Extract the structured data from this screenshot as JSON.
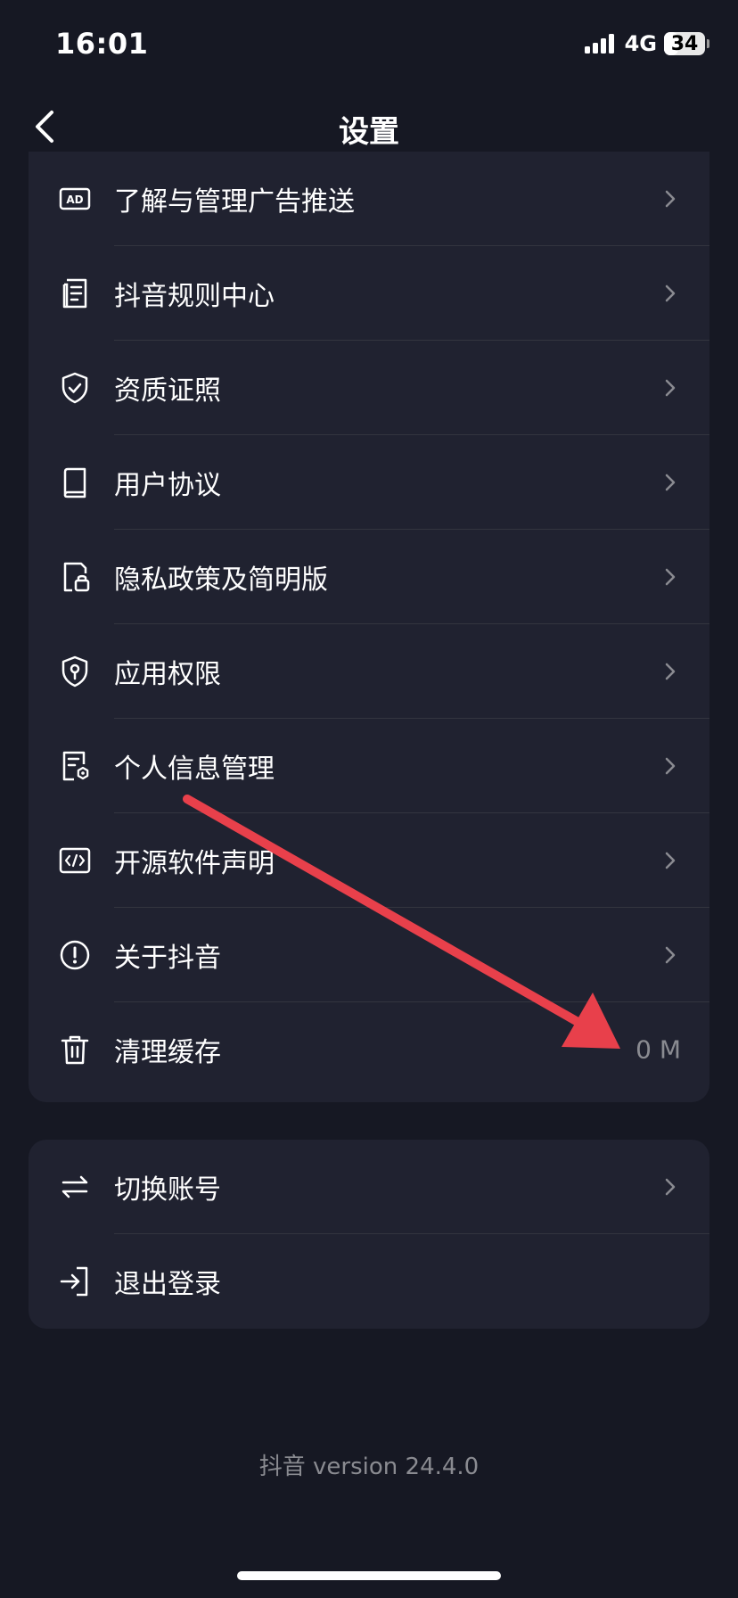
{
  "status_bar": {
    "time": "16:01",
    "network": "4G",
    "battery": "34",
    "battery_level_percent": 34
  },
  "header": {
    "title": "设置"
  },
  "settings_items": [
    {
      "label": "了解与管理广告推送",
      "icon": "ad-icon"
    },
    {
      "label": "抖音规则中心",
      "icon": "document-list-icon"
    },
    {
      "label": "资质证照",
      "icon": "shield-check-icon"
    },
    {
      "label": "用户协议",
      "icon": "book-icon"
    },
    {
      "label": "隐私政策及简明版",
      "icon": "lock-document-icon"
    },
    {
      "label": "应用权限",
      "icon": "shield-key-icon"
    },
    {
      "label": "个人信息管理",
      "icon": "document-settings-icon"
    },
    {
      "label": "开源软件声明",
      "icon": "code-icon"
    },
    {
      "label": "关于抖音",
      "icon": "info-circle-icon"
    },
    {
      "label": "清理缓存",
      "icon": "trash-icon",
      "value": "0 M"
    }
  ],
  "account_items": [
    {
      "label": "切换账号",
      "icon": "swap-icon"
    },
    {
      "label": "退出登录",
      "icon": "logout-icon"
    }
  ],
  "footer": {
    "version": "抖音 version 24.4.0"
  },
  "colors": {
    "background": "#161823",
    "card": "#202230",
    "divider": "#33353f",
    "secondary_text": "#8a8b91",
    "annotation_arrow": "#e8404b"
  }
}
